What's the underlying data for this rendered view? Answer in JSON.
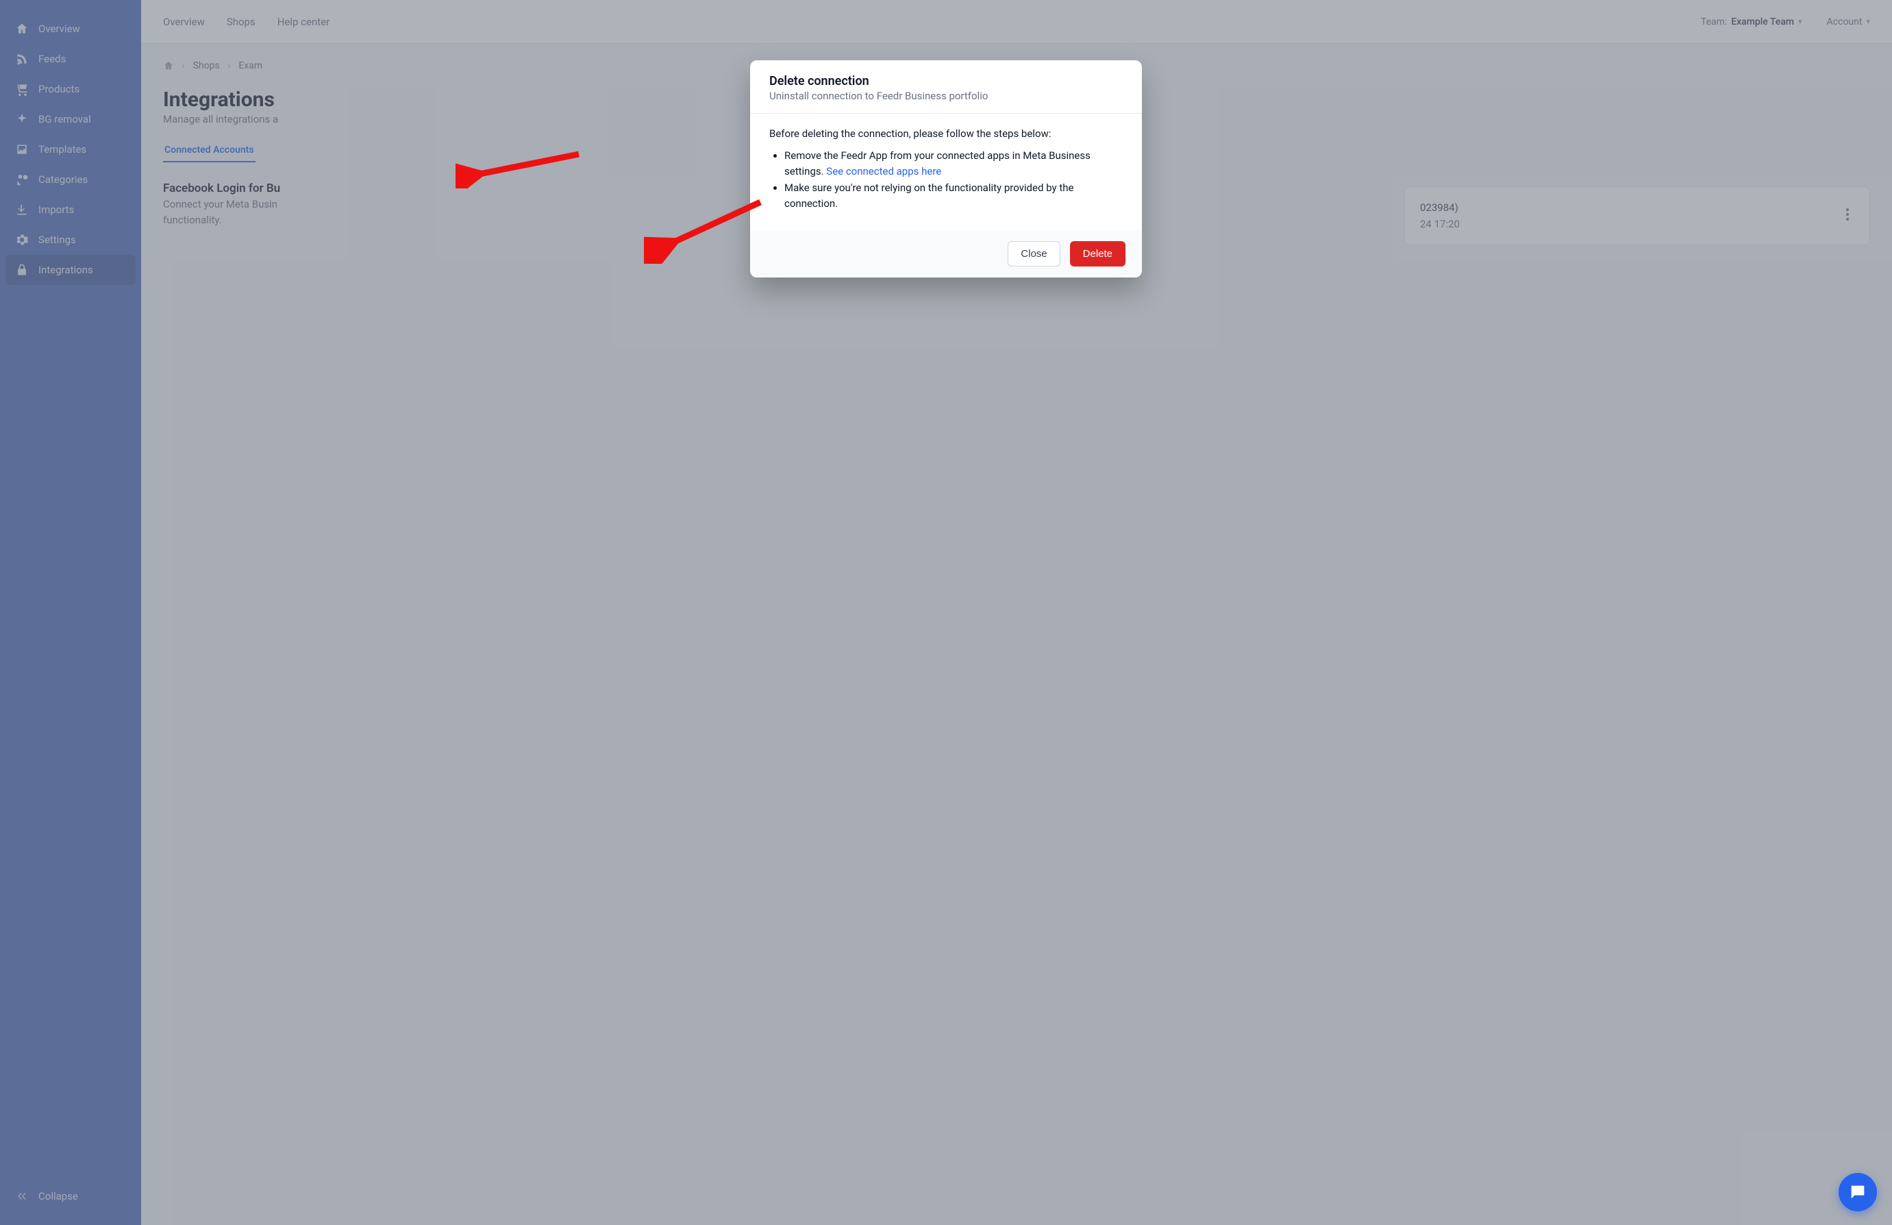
{
  "sidebar": {
    "items": [
      {
        "label": "Overview",
        "icon": "home-icon"
      },
      {
        "label": "Feeds",
        "icon": "rss-icon"
      },
      {
        "label": "Products",
        "icon": "cart-icon"
      },
      {
        "label": "BG removal",
        "icon": "sparkle-icon"
      },
      {
        "label": "Templates",
        "icon": "image-icon"
      },
      {
        "label": "Categories",
        "icon": "shapes-icon"
      },
      {
        "label": "Imports",
        "icon": "download-icon"
      },
      {
        "label": "Settings",
        "icon": "gear-icon"
      },
      {
        "label": "Integrations",
        "icon": "lock-icon"
      }
    ],
    "collapse": "Collapse"
  },
  "topbar": {
    "links": [
      "Overview",
      "Shops",
      "Help center"
    ],
    "team_prefix": "Team: ",
    "team_name": "Example Team",
    "account_label": "Account"
  },
  "breadcrumb": {
    "items": [
      "Shops",
      "Exam"
    ]
  },
  "page": {
    "title": "Integrations",
    "subtitle": "Manage all integrations a"
  },
  "tabs": {
    "active": "Connected Accounts"
  },
  "section": {
    "title": "Facebook Login for Bu",
    "subtitle_line1": "Connect your Meta Busin",
    "subtitle_line2": "functionality."
  },
  "card": {
    "id_suffix": "023984)",
    "date_suffix": "24 17:20"
  },
  "modal": {
    "title": "Delete connection",
    "subtitle": "Uninstall connection to Feedr Business portfolio",
    "intro": "Before deleting the connection, please follow the steps below:",
    "li1_a": "Remove the Feedr App from your connected apps in Meta Business settings. ",
    "li1_link": "See connected apps here",
    "li2": "Make sure you're not relying on the functionality provided by the connection.",
    "close": "Close",
    "delete": "Delete"
  },
  "arrows": {
    "arrow1": {
      "note": "points to 'See connected apps here' link"
    },
    "arrow2": {
      "note": "points to Delete button"
    }
  }
}
